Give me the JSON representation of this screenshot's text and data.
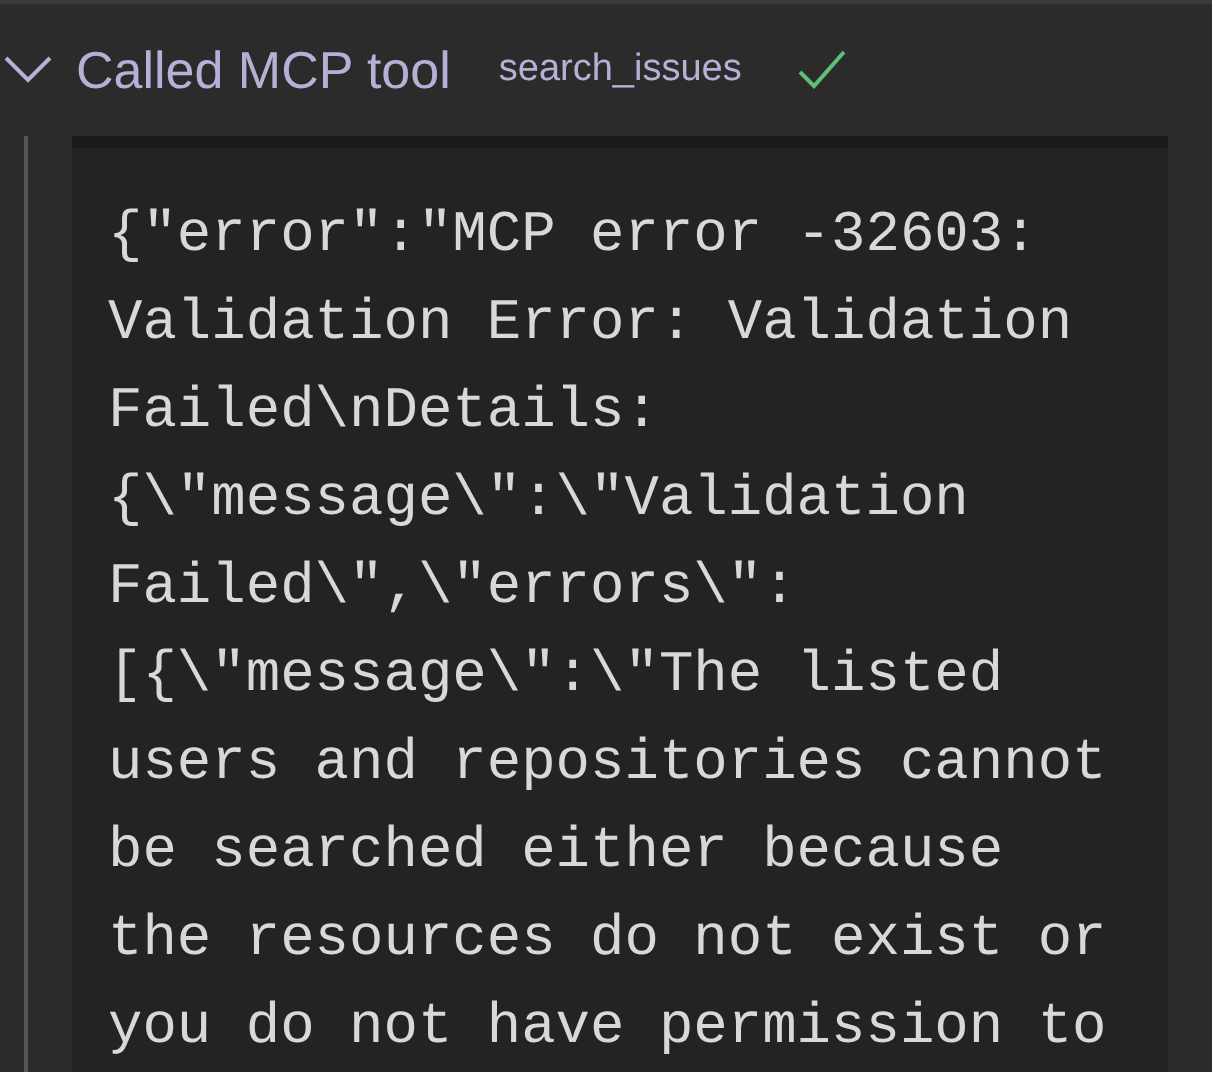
{
  "tool_call": {
    "expanded": true,
    "label": "Called MCP tool",
    "tool_name": "search_issues",
    "succeeded": true
  },
  "output": "{\"error\":\"MCP error -32603: Validation Error: Validation Failed\\nDetails:{\\\"message\\\":\\\"Validation Failed\\\",\\\"errors\\\":[{\\\"message\\\":\\\"The listed users and repositories cannot be searched either because the resources do not exist or you do not have permission to"
}
